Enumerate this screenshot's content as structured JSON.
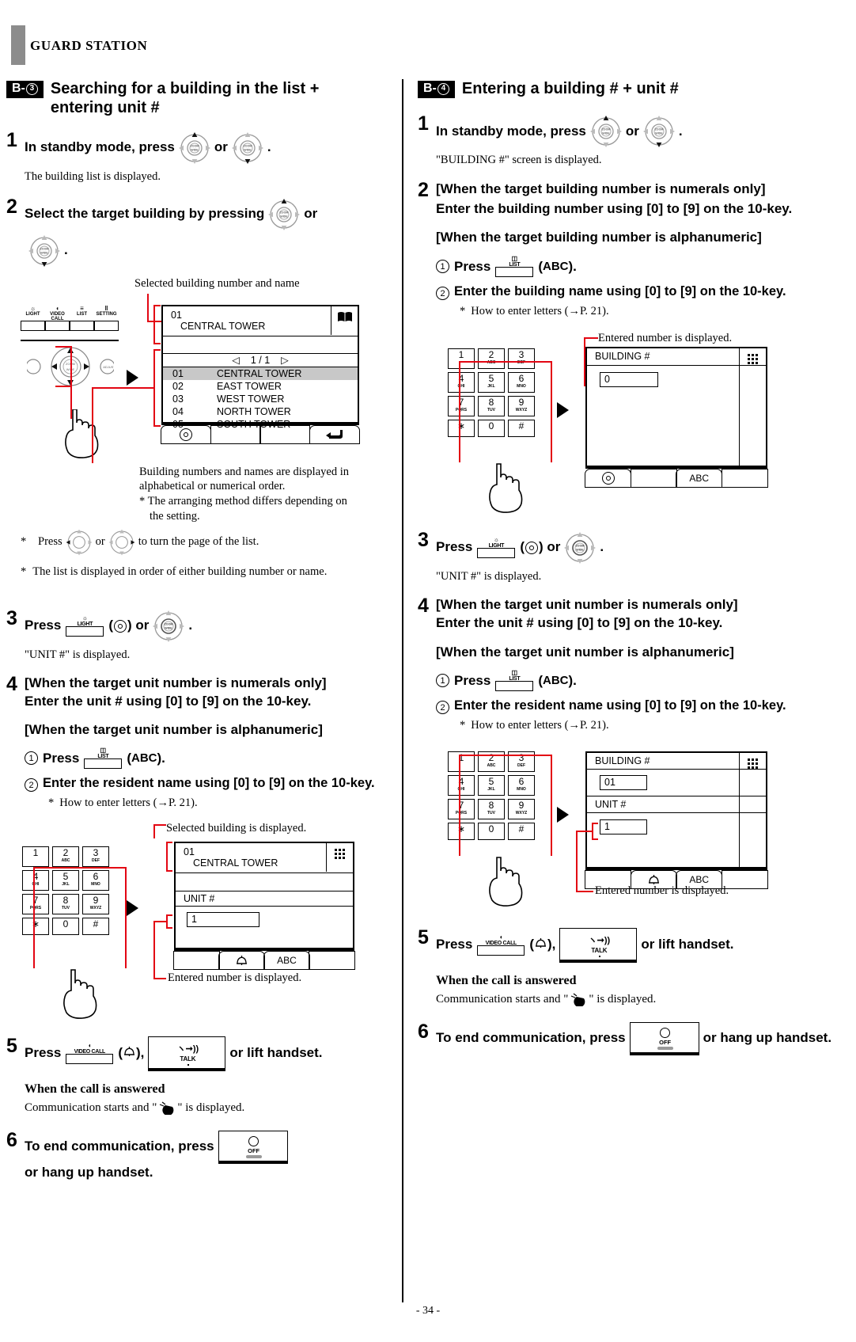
{
  "header": {
    "title": "GUARD STATION"
  },
  "page_number": "- 34 -",
  "icons": {
    "navpad": "nav-pad-icon",
    "light_key": "light-key-icon",
    "list_key": "list-key-icon",
    "video_call_key": "video-call-key-icon",
    "talk_key": "talk-key-icon",
    "off_key": "off-key-icon",
    "book": "book-icon",
    "keypad_grid": "keypad-grid-icon",
    "bell": "bell-icon",
    "return": "return-arrow-icon",
    "hand": "pointing-hand-icon"
  },
  "keypad": {
    "keys": [
      {
        "num": "1",
        "sub": ""
      },
      {
        "num": "2",
        "sub": "ABC"
      },
      {
        "num": "3",
        "sub": "DEF"
      },
      {
        "num": "4",
        "sub": "GHI"
      },
      {
        "num": "5",
        "sub": "JKL"
      },
      {
        "num": "6",
        "sub": "MNO"
      },
      {
        "num": "7",
        "sub": "PQRS"
      },
      {
        "num": "8",
        "sub": "TUV"
      },
      {
        "num": "9",
        "sub": "WXYZ"
      },
      {
        "num": "∗",
        "sub": ""
      },
      {
        "num": "0",
        "sub": ""
      },
      {
        "num": "#",
        "sub": ""
      }
    ]
  },
  "device_panel": {
    "keys": [
      "LIGHT",
      "VIDEO CALL",
      "LIST",
      "SETTING"
    ],
    "zoom_label": "ZOOM",
    "wide_label": "WIDE",
    "adjust_label": "ADJUST"
  },
  "left": {
    "section": {
      "badge_letter": "B-",
      "badge_num": "3",
      "title": "Searching for a building in the list + entering unit #"
    },
    "step1": {
      "num": "1",
      "text_before": "In standby mode, press",
      "or": "or",
      "period": ".",
      "note": "The building list is displayed."
    },
    "step2": {
      "num": "2",
      "text_before": "Select the target building by pressing",
      "or": "or",
      "period": "."
    },
    "callouts": {
      "top": "Selected building number and name",
      "bottom_line1": "Building numbers and names are displayed in",
      "bottom_line2": "alphabetical or numerical order.",
      "bottom_line3": "* The arranging method differs depending on",
      "bottom_line4": "the setting."
    },
    "lcd_list": {
      "header_num": "01",
      "header_name": "CENTRAL TOWER",
      "pager": "1 / 1",
      "pager_left": "◁",
      "pager_right": "▷",
      "rows": [
        {
          "num": "01",
          "name": "CENTRAL TOWER",
          "selected": true
        },
        {
          "num": "02",
          "name": "EAST TOWER",
          "selected": false
        },
        {
          "num": "03",
          "name": "WEST TOWER",
          "selected": false
        },
        {
          "num": "04",
          "name": "NORTH TOWER",
          "selected": false
        },
        {
          "num": "05",
          "name": "SOUTH TOWER",
          "selected": false
        }
      ]
    },
    "star1": {
      "star": "*",
      "a": "Press",
      "or": "or",
      "b": "to turn the page of the list."
    },
    "star2": {
      "star": "*",
      "text": "The list is displayed in order of either building number or name."
    },
    "step3": {
      "num": "3",
      "press": "Press",
      "key_label": "LIGHT",
      "or": ") or",
      "period": ".",
      "note": "\"UNIT #\" is displayed."
    },
    "step4": {
      "num": "4",
      "line1": "[When the target unit number is numerals only]",
      "line2": "Enter the unit # using [0] to [9] on the 10-key.",
      "line3": "[When the target unit number is alphanumeric]",
      "sub1_num": "1",
      "sub1_press": "Press",
      "sub1_key": "LIST",
      "sub1_abc": "ABC",
      "sub1_tail": ").",
      "sub2_num": "2",
      "sub2_text": "Enter the resident name using [0] to [9] on the 10-key.",
      "sub2_star": "*",
      "sub2_note": "How to enter letters (→P. 21)."
    },
    "lcd_unit": {
      "callout_top": "Selected building is displayed.",
      "callout_bottom": "Entered number is displayed.",
      "header_num": "01",
      "header_name": "CENTRAL TOWER",
      "unit_label": "UNIT #",
      "unit_value": "1",
      "softkey_abc": "ABC"
    },
    "step5": {
      "num": "5",
      "press": "Press",
      "key_label": "VIDEO CALL",
      "comma": "),",
      "talk_label": "TALK",
      "tail": "or lift handset.",
      "answered_head": "When the call is answered",
      "answered_body_a": "Communication starts and \"",
      "answered_body_b": "\" is displayed."
    },
    "step6": {
      "num": "6",
      "text_a": "To end communication, press",
      "off_label": "OFF",
      "text_b": "or hang up handset."
    }
  },
  "right": {
    "section": {
      "badge_letter": "B-",
      "badge_num": "4",
      "title": "Entering a building # + unit #"
    },
    "step1": {
      "num": "1",
      "text_before": "In standby mode, press",
      "or": "or",
      "period": ".",
      "note": "\"BUILDING #\" screen is displayed."
    },
    "step2": {
      "num": "2",
      "line1": "[When the target building number is numerals only]",
      "line2": "Enter the building number using [0] to [9] on the 10-key.",
      "line3": "[When the target building number is alphanumeric]",
      "sub1_num": "1",
      "sub1_press": "Press",
      "sub1_key": "LIST",
      "sub1_abc": "ABC",
      "sub1_tail": ").",
      "sub2_num": "2",
      "sub2_text": "Enter the building name using [0] to [9] on the 10-key.",
      "sub2_star": "*",
      "sub2_note": "How to enter letters (→P. 21)."
    },
    "lcd_building": {
      "callout_top": "Entered number is displayed.",
      "label": "BUILDING #",
      "value": "0",
      "softkey_abc": "ABC"
    },
    "step3": {
      "num": "3",
      "press": "Press",
      "key_label": "LIGHT",
      "or": ") or",
      "period": ".",
      "note": "\"UNIT #\" is displayed."
    },
    "step4": {
      "num": "4",
      "line1": "[When the target unit number is numerals only]",
      "line2": "Enter the unit # using [0] to [9] on the 10-key.",
      "line3": "[When the target unit number is alphanumeric]",
      "sub1_num": "1",
      "sub1_press": "Press",
      "sub1_key": "LIST",
      "sub1_abc": "ABC",
      "sub1_tail": ").",
      "sub2_num": "2",
      "sub2_text": "Enter the resident name using [0] to [9] on the 10-key.",
      "sub2_star": "*",
      "sub2_note": "How to enter letters (→P. 21)."
    },
    "lcd_both": {
      "callout_bottom": "Entered number is displayed.",
      "building_label": "BUILDING #",
      "building_value": "01",
      "unit_label": "UNIT #",
      "unit_value": "1",
      "softkey_abc": "ABC"
    },
    "step5": {
      "num": "5",
      "press": "Press",
      "key_label": "VIDEO CALL",
      "comma": "),",
      "talk_label": "TALK",
      "tail": "or lift handset.",
      "answered_head": "When the call is answered",
      "answered_body_a": "Communication starts and \"",
      "answered_body_b": "\" is displayed."
    },
    "step6": {
      "num": "6",
      "text_a": "To end communication, press",
      "off_label": "OFF",
      "text_b": "or hang up handset."
    }
  }
}
